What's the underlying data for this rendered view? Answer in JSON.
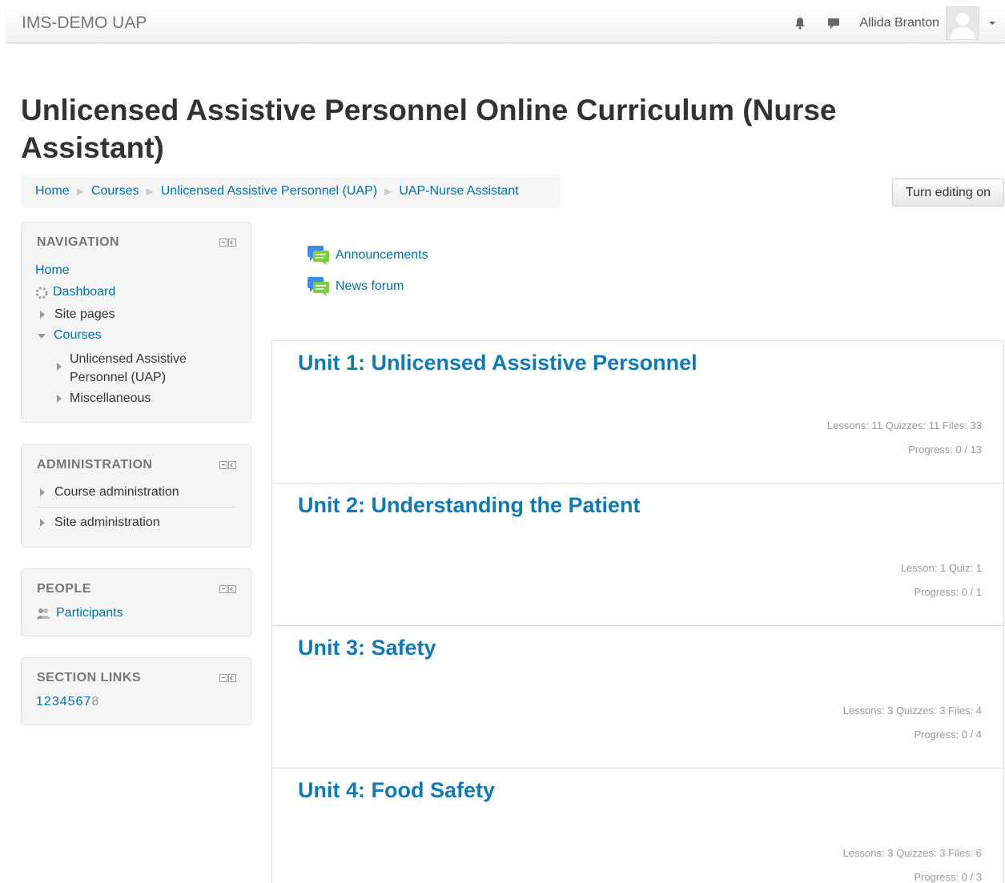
{
  "navbar": {
    "brand": "IMS-DEMO UAP",
    "user_name": "Allida Branton",
    "icons": [
      "notification-bell-icon",
      "messages-icon",
      "user-menu-caret-icon"
    ]
  },
  "page": {
    "title": "Unlicensed Assistive Personnel Online Curriculum (Nurse Assistant)"
  },
  "breadcrumb": [
    "Home",
    "Courses",
    "Unlicensed Assistive Personnel (UAP)",
    "UAP-Nurse Assistant"
  ],
  "edit_button": "Turn editing on",
  "navigation": {
    "title": "NAVIGATION",
    "home": "Home",
    "dashboard": "Dashboard",
    "site_pages": "Site pages",
    "courses": "Courses",
    "uap_course_line1": "Unlicensed Assistive",
    "uap_course_line2": "Personnel (UAP)",
    "misc": "Miscellaneous"
  },
  "administration": {
    "title": "ADMINISTRATION",
    "course_admin": "Course administration",
    "site_admin": "Site administration"
  },
  "people": {
    "title": "PEOPLE",
    "participants": "Participants"
  },
  "section_links": {
    "title": "SECTION LINKS",
    "links": [
      "1",
      "2",
      "3",
      "4",
      "5",
      "6",
      "7"
    ],
    "inactive": "8"
  },
  "activities": [
    "Announcements",
    "News forum"
  ],
  "sections": [
    {
      "title": "Unit 1: Unlicensed Assistive Personnel",
      "counts": "Lessons: 11  Quizzes: 11  Files: 33",
      "progress": "Progress: 0 / 13"
    },
    {
      "title": "Unit 2: Understanding the Patient",
      "counts": "Lesson: 1  Quiz: 1",
      "progress": "Progress: 0 / 1"
    },
    {
      "title": "Unit 3: Safety",
      "counts": "Lessons: 3  Quizzes: 3  Files: 4",
      "progress": "Progress: 0 / 4"
    },
    {
      "title": "Unit 4: Food Safety",
      "counts": "Lessons: 3  Quizzes: 3  Files: 6",
      "progress": "Progress: 0 / 3"
    }
  ],
  "colors": {
    "link": "#0070a8",
    "section_title": "#0f7ab5",
    "block_bg": "#f5f5f5",
    "muted": "#999999"
  }
}
